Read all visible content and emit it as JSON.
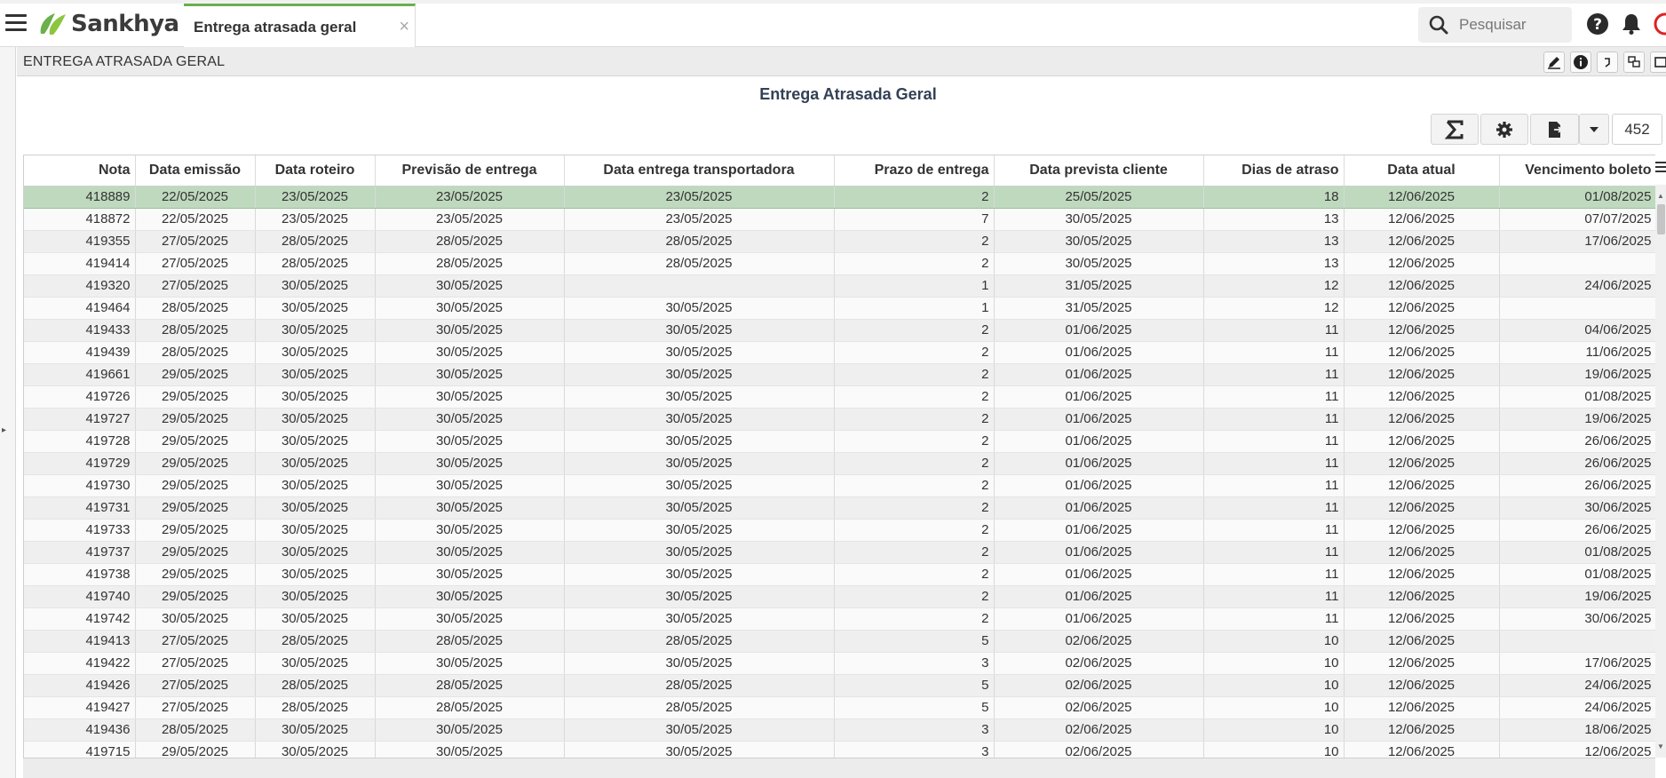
{
  "app": {
    "brand": "Sankhya",
    "tab_title": "Entrega atrasada geral",
    "tab_close": "×",
    "search_placeholder": "Pesquisar"
  },
  "panel": {
    "header_title": "ENTREGA ATRASADA GERAL",
    "report_title": "Entrega Atrasada Geral",
    "record_count": "452"
  },
  "colors": {
    "accent": "#6ab04c",
    "selected_row": "#bfd9bf",
    "title_text": "#334155"
  },
  "table": {
    "headers": [
      "Nota",
      "Data emissão",
      "Data roteiro",
      "Previsão de entrega",
      "Data entrega transportadora",
      "Prazo de entrega",
      "Data prevista cliente",
      "Dias de atraso",
      "Data atual",
      "Vencimento boleto"
    ],
    "rows": [
      [
        "418889",
        "22/05/2025",
        "23/05/2025",
        "23/05/2025",
        "23/05/2025",
        "2",
        "25/05/2025",
        "18",
        "12/06/2025",
        "01/08/2025"
      ],
      [
        "418872",
        "22/05/2025",
        "23/05/2025",
        "23/05/2025",
        "23/05/2025",
        "7",
        "30/05/2025",
        "13",
        "12/06/2025",
        "07/07/2025"
      ],
      [
        "419355",
        "27/05/2025",
        "28/05/2025",
        "28/05/2025",
        "28/05/2025",
        "2",
        "30/05/2025",
        "13",
        "12/06/2025",
        "17/06/2025"
      ],
      [
        "419414",
        "27/05/2025",
        "28/05/2025",
        "28/05/2025",
        "28/05/2025",
        "2",
        "30/05/2025",
        "13",
        "12/06/2025",
        ""
      ],
      [
        "419320",
        "27/05/2025",
        "30/05/2025",
        "30/05/2025",
        "",
        "1",
        "31/05/2025",
        "12",
        "12/06/2025",
        "24/06/2025"
      ],
      [
        "419464",
        "28/05/2025",
        "30/05/2025",
        "30/05/2025",
        "30/05/2025",
        "1",
        "31/05/2025",
        "12",
        "12/06/2025",
        ""
      ],
      [
        "419433",
        "28/05/2025",
        "30/05/2025",
        "30/05/2025",
        "30/05/2025",
        "2",
        "01/06/2025",
        "11",
        "12/06/2025",
        "04/06/2025"
      ],
      [
        "419439",
        "28/05/2025",
        "30/05/2025",
        "30/05/2025",
        "30/05/2025",
        "2",
        "01/06/2025",
        "11",
        "12/06/2025",
        "11/06/2025"
      ],
      [
        "419661",
        "29/05/2025",
        "30/05/2025",
        "30/05/2025",
        "30/05/2025",
        "2",
        "01/06/2025",
        "11",
        "12/06/2025",
        "19/06/2025"
      ],
      [
        "419726",
        "29/05/2025",
        "30/05/2025",
        "30/05/2025",
        "30/05/2025",
        "2",
        "01/06/2025",
        "11",
        "12/06/2025",
        "01/08/2025"
      ],
      [
        "419727",
        "29/05/2025",
        "30/05/2025",
        "30/05/2025",
        "30/05/2025",
        "2",
        "01/06/2025",
        "11",
        "12/06/2025",
        "19/06/2025"
      ],
      [
        "419728",
        "29/05/2025",
        "30/05/2025",
        "30/05/2025",
        "30/05/2025",
        "2",
        "01/06/2025",
        "11",
        "12/06/2025",
        "26/06/2025"
      ],
      [
        "419729",
        "29/05/2025",
        "30/05/2025",
        "30/05/2025",
        "30/05/2025",
        "2",
        "01/06/2025",
        "11",
        "12/06/2025",
        "26/06/2025"
      ],
      [
        "419730",
        "29/05/2025",
        "30/05/2025",
        "30/05/2025",
        "30/05/2025",
        "2",
        "01/06/2025",
        "11",
        "12/06/2025",
        "26/06/2025"
      ],
      [
        "419731",
        "29/05/2025",
        "30/05/2025",
        "30/05/2025",
        "30/05/2025",
        "2",
        "01/06/2025",
        "11",
        "12/06/2025",
        "30/06/2025"
      ],
      [
        "419733",
        "29/05/2025",
        "30/05/2025",
        "30/05/2025",
        "30/05/2025",
        "2",
        "01/06/2025",
        "11",
        "12/06/2025",
        "26/06/2025"
      ],
      [
        "419737",
        "29/05/2025",
        "30/05/2025",
        "30/05/2025",
        "30/05/2025",
        "2",
        "01/06/2025",
        "11",
        "12/06/2025",
        "01/08/2025"
      ],
      [
        "419738",
        "29/05/2025",
        "30/05/2025",
        "30/05/2025",
        "30/05/2025",
        "2",
        "01/06/2025",
        "11",
        "12/06/2025",
        "01/08/2025"
      ],
      [
        "419740",
        "29/05/2025",
        "30/05/2025",
        "30/05/2025",
        "30/05/2025",
        "2",
        "01/06/2025",
        "11",
        "12/06/2025",
        "19/06/2025"
      ],
      [
        "419742",
        "30/05/2025",
        "30/05/2025",
        "30/05/2025",
        "30/05/2025",
        "2",
        "01/06/2025",
        "11",
        "12/06/2025",
        "30/06/2025"
      ],
      [
        "419413",
        "27/05/2025",
        "28/05/2025",
        "28/05/2025",
        "28/05/2025",
        "5",
        "02/06/2025",
        "10",
        "12/06/2025",
        ""
      ],
      [
        "419422",
        "27/05/2025",
        "30/05/2025",
        "30/05/2025",
        "30/05/2025",
        "3",
        "02/06/2025",
        "10",
        "12/06/2025",
        "17/06/2025"
      ],
      [
        "419426",
        "27/05/2025",
        "28/05/2025",
        "28/05/2025",
        "28/05/2025",
        "5",
        "02/06/2025",
        "10",
        "12/06/2025",
        "24/06/2025"
      ],
      [
        "419427",
        "27/05/2025",
        "28/05/2025",
        "28/05/2025",
        "28/05/2025",
        "5",
        "02/06/2025",
        "10",
        "12/06/2025",
        "24/06/2025"
      ],
      [
        "419436",
        "28/05/2025",
        "30/05/2025",
        "30/05/2025",
        "30/05/2025",
        "3",
        "02/06/2025",
        "10",
        "12/06/2025",
        "18/06/2025"
      ],
      [
        "419715",
        "29/05/2025",
        "30/05/2025",
        "30/05/2025",
        "30/05/2025",
        "3",
        "02/06/2025",
        "10",
        "12/06/2025",
        "12/06/2025"
      ]
    ]
  }
}
